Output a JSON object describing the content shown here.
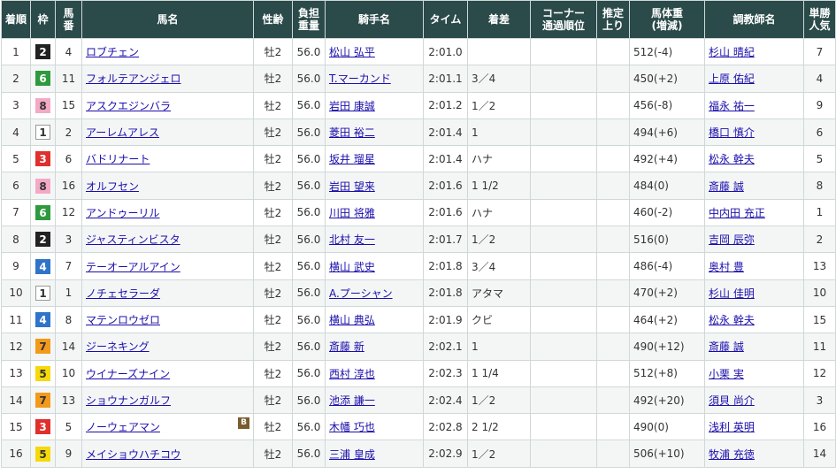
{
  "headers": {
    "rank": "着順",
    "waku": "枠",
    "umaban_1": "馬",
    "umaban_2": "番",
    "horse": "馬名",
    "sex_age": "性齢",
    "weight_1": "負担",
    "weight_2": "重量",
    "jockey": "騎手名",
    "time": "タイム",
    "margin": "着差",
    "corner_1": "コーナー",
    "corner_2": "通過順位",
    "last3f_1": "推定",
    "last3f_2": "上り",
    "body_1": "馬体重",
    "body_2": "(増減)",
    "trainer": "調教師名",
    "pop_1": "単勝",
    "pop_2": "人気"
  },
  "waku_colors": {
    "1": {
      "bg": "#ffffff",
      "fg": "#333333",
      "border": "#999999"
    },
    "2": {
      "bg": "#222222",
      "fg": "#ffffff",
      "border": "#222222"
    },
    "3": {
      "bg": "#e0302d",
      "fg": "#ffffff",
      "border": "#e0302d"
    },
    "4": {
      "bg": "#2f74c9",
      "fg": "#ffffff",
      "border": "#2f74c9"
    },
    "5": {
      "bg": "#f5d90a",
      "fg": "#333333",
      "border": "#f5d90a"
    },
    "6": {
      "bg": "#2e9a3e",
      "fg": "#ffffff",
      "border": "#2e9a3e"
    },
    "7": {
      "bg": "#f39a1c",
      "fg": "#333333",
      "border": "#f39a1c"
    },
    "8": {
      "bg": "#f4a9c6",
      "fg": "#333333",
      "border": "#f4a9c6"
    }
  },
  "rows": [
    {
      "rank": "1",
      "waku": "2",
      "umaban": "4",
      "horse": "ロブチェン",
      "blinker": "",
      "sex_age": "牡2",
      "weight": "56.0",
      "jockey": "松山 弘平",
      "time": "2:01.0",
      "margin": "",
      "corner": "",
      "last3f": "",
      "body": "512",
      "body_diff": "(-4)",
      "trainer": "杉山 晴紀",
      "pop": "7"
    },
    {
      "rank": "2",
      "waku": "6",
      "umaban": "11",
      "horse": "フォルテアンジェロ",
      "blinker": "",
      "sex_age": "牡2",
      "weight": "56.0",
      "jockey": "T.マーカンド",
      "time": "2:01.1",
      "margin": "3／4",
      "corner": "",
      "last3f": "",
      "body": "450",
      "body_diff": "(+2)",
      "trainer": "上原 佑紀",
      "pop": "4"
    },
    {
      "rank": "3",
      "waku": "8",
      "umaban": "15",
      "horse": "アスクエジンバラ",
      "blinker": "",
      "sex_age": "牡2",
      "weight": "56.0",
      "jockey": "岩田 康誠",
      "time": "2:01.2",
      "margin": "1／2",
      "corner": "",
      "last3f": "",
      "body": "456",
      "body_diff": "(-8)",
      "trainer": "福永 祐一",
      "pop": "9"
    },
    {
      "rank": "4",
      "waku": "1",
      "umaban": "2",
      "horse": "アーレムアレス",
      "blinker": "",
      "sex_age": "牡2",
      "weight": "56.0",
      "jockey": "菱田 裕二",
      "time": "2:01.4",
      "margin": "1",
      "corner": "",
      "last3f": "",
      "body": "494",
      "body_diff": "(+6)",
      "trainer": "橋口 慎介",
      "pop": "6"
    },
    {
      "rank": "5",
      "waku": "3",
      "umaban": "6",
      "horse": "バドリナート",
      "blinker": "",
      "sex_age": "牡2",
      "weight": "56.0",
      "jockey": "坂井 瑠星",
      "time": "2:01.4",
      "margin": "ハナ",
      "corner": "",
      "last3f": "",
      "body": "492",
      "body_diff": "(+4)",
      "trainer": "松永 幹夫",
      "pop": "5"
    },
    {
      "rank": "6",
      "waku": "8",
      "umaban": "16",
      "horse": "オルフセン",
      "blinker": "",
      "sex_age": "牡2",
      "weight": "56.0",
      "jockey": "岩田 望来",
      "time": "2:01.6",
      "margin": "1 1/2",
      "corner": "",
      "last3f": "",
      "body": "484",
      "body_diff": "(0)",
      "trainer": "斎藤 誠",
      "pop": "8"
    },
    {
      "rank": "7",
      "waku": "6",
      "umaban": "12",
      "horse": "アンドゥーリル",
      "blinker": "",
      "sex_age": "牡2",
      "weight": "56.0",
      "jockey": "川田 将雅",
      "time": "2:01.6",
      "margin": "ハナ",
      "corner": "",
      "last3f": "",
      "body": "460",
      "body_diff": "(-2)",
      "trainer": "中内田 充正",
      "pop": "1"
    },
    {
      "rank": "8",
      "waku": "2",
      "umaban": "3",
      "horse": "ジャスティンビスタ",
      "blinker": "",
      "sex_age": "牡2",
      "weight": "56.0",
      "jockey": "北村 友一",
      "time": "2:01.7",
      "margin": "1／2",
      "corner": "",
      "last3f": "",
      "body": "516",
      "body_diff": "(0)",
      "trainer": "吉岡 辰弥",
      "pop": "2"
    },
    {
      "rank": "9",
      "waku": "4",
      "umaban": "7",
      "horse": "テーオーアルアイン",
      "blinker": "",
      "sex_age": "牡2",
      "weight": "56.0",
      "jockey": "横山 武史",
      "time": "2:01.8",
      "margin": "3／4",
      "corner": "",
      "last3f": "",
      "body": "486",
      "body_diff": "(-4)",
      "trainer": "奥村 豊",
      "pop": "13"
    },
    {
      "rank": "10",
      "waku": "1",
      "umaban": "1",
      "horse": "ノチェセラーダ",
      "blinker": "",
      "sex_age": "牡2",
      "weight": "56.0",
      "jockey": "A.プーシャン",
      "time": "2:01.8",
      "margin": "アタマ",
      "corner": "",
      "last3f": "",
      "body": "470",
      "body_diff": "(+2)",
      "trainer": "杉山 佳明",
      "pop": "10"
    },
    {
      "rank": "11",
      "waku": "4",
      "umaban": "8",
      "horse": "マテンロウゼロ",
      "blinker": "",
      "sex_age": "牡2",
      "weight": "56.0",
      "jockey": "横山 典弘",
      "time": "2:01.9",
      "margin": "クビ",
      "corner": "",
      "last3f": "",
      "body": "464",
      "body_diff": "(+2)",
      "trainer": "松永 幹夫",
      "pop": "15"
    },
    {
      "rank": "12",
      "waku": "7",
      "umaban": "14",
      "horse": "ジーネキング",
      "blinker": "",
      "sex_age": "牡2",
      "weight": "56.0",
      "jockey": "斎藤 新",
      "time": "2:02.1",
      "margin": "1",
      "corner": "",
      "last3f": "",
      "body": "490",
      "body_diff": "(+12)",
      "trainer": "斎藤 誠",
      "pop": "11"
    },
    {
      "rank": "13",
      "waku": "5",
      "umaban": "10",
      "horse": "ウイナーズナイン",
      "blinker": "",
      "sex_age": "牡2",
      "weight": "56.0",
      "jockey": "西村 淳也",
      "time": "2:02.3",
      "margin": "1 1/4",
      "corner": "",
      "last3f": "",
      "body": "512",
      "body_diff": "(+8)",
      "trainer": "小栗 実",
      "pop": "12"
    },
    {
      "rank": "14",
      "waku": "7",
      "umaban": "13",
      "horse": "ショウナンガルフ",
      "blinker": "",
      "sex_age": "牡2",
      "weight": "56.0",
      "jockey": "池添 謙一",
      "time": "2:02.4",
      "margin": "1／2",
      "corner": "",
      "last3f": "",
      "body": "492",
      "body_diff": "(+20)",
      "trainer": "須貝 尚介",
      "pop": "3"
    },
    {
      "rank": "15",
      "waku": "3",
      "umaban": "5",
      "horse": "ノーウェアマン",
      "blinker": "B",
      "sex_age": "牡2",
      "weight": "56.0",
      "jockey": "木幡 巧也",
      "time": "2:02.8",
      "margin": "2 1/2",
      "corner": "",
      "last3f": "",
      "body": "490",
      "body_diff": "(0)",
      "trainer": "浅利 英明",
      "pop": "16"
    },
    {
      "rank": "16",
      "waku": "5",
      "umaban": "9",
      "horse": "メイショウハチコウ",
      "blinker": "",
      "sex_age": "牡2",
      "weight": "56.0",
      "jockey": "三浦 皇成",
      "time": "2:02.9",
      "margin": "1／2",
      "corner": "",
      "last3f": "",
      "body": "506",
      "body_diff": "(+10)",
      "trainer": "牧浦 充徳",
      "pop": "14"
    }
  ]
}
